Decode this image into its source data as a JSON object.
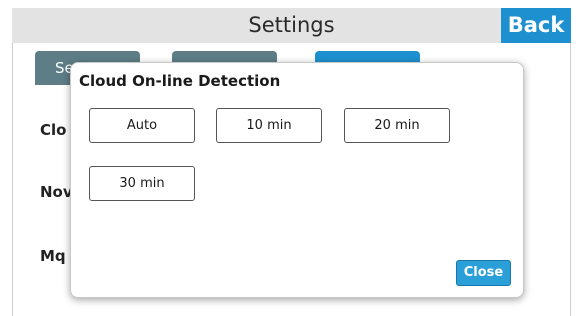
{
  "header": {
    "title": "Settings",
    "back_label": "Back"
  },
  "background": {
    "tab1_partial": "Se",
    "labels": [
      "Clo",
      "Nov",
      "Mq"
    ]
  },
  "modal": {
    "title": "Cloud On-line Detection",
    "options": [
      "Auto",
      "10 min",
      "20 min",
      "30 min"
    ],
    "close_label": "Close"
  },
  "colors": {
    "accent": "#1e90d0",
    "tab_inactive": "#5d7d87",
    "header_bg": "#e3e3e3"
  }
}
